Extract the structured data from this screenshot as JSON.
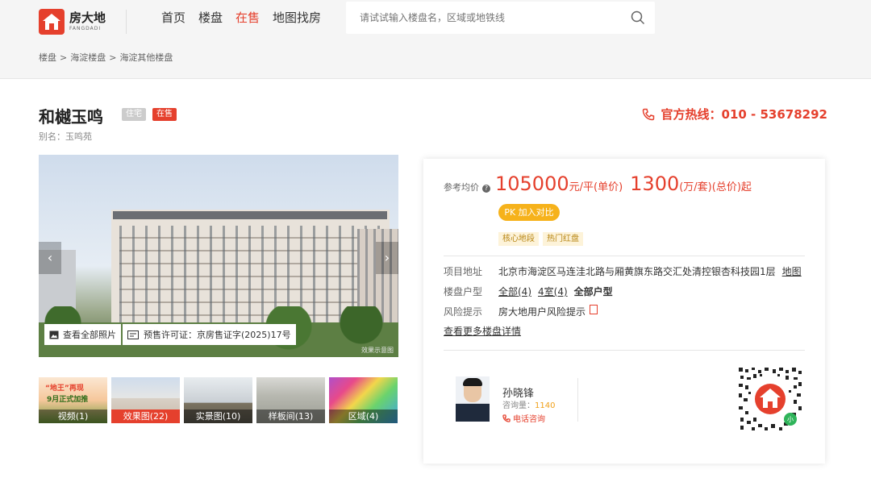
{
  "header": {
    "logo_cn": "房大地",
    "logo_en": "FANGDADI",
    "nav": [
      "首页",
      "楼盘",
      "在售",
      "地图找房"
    ],
    "nav_active_index": 2,
    "search_placeholder": "请试试输入楼盘名，区域或地铁线"
  },
  "breadcrumb": [
    "楼盘",
    "海淀楼盘",
    "海淀其他楼盘"
  ],
  "breadcrumb_sep": ">",
  "project": {
    "name": "和樾玉鸣",
    "type_tag": "住宅",
    "status_tag": "在售",
    "alias": "别名：玉鸣苑",
    "hotline": "官方热线：010 - 53678292"
  },
  "gallery": {
    "view_all": "查看全部照片",
    "permit": "预售许可证：京房售证字(2025)17号",
    "watermark": "效果示意图",
    "prev": "‹",
    "next": "›",
    "thumb_overlay": [
      "“地王”再现",
      "9月正式加推"
    ],
    "thumbs": [
      "视频(1)",
      "效果图(22)",
      "实景图(10)",
      "样板间(13)",
      "区域(4)"
    ],
    "selected_thumb": 1
  },
  "summary": {
    "price_label": "参考均价",
    "unit_price": "105000",
    "unit_price_suffix": "元/平(单价)",
    "total_price": "1300",
    "total_price_suffix": "(万/套)(总价)起",
    "pk_button": "PK 加入对比",
    "features": [
      "核心地段",
      "热门红盘"
    ],
    "address_label": "项目地址",
    "address": "北京市海淀区马连洼北路与厢黄旗东路交汇处清控银杏科技园1层",
    "map_link": "地图",
    "layout_label": "楼盘户型",
    "layouts": [
      "全部(4)",
      "4室(4)"
    ],
    "all_layouts": "全部户型",
    "risk_label": "风险提示",
    "risk_text": "房大地用户风险提示",
    "more_details": "查看更多楼盘详情"
  },
  "agent": {
    "name": "孙晓锋",
    "consult_label": "咨询量：",
    "consult_count": "1140",
    "call": "电话咨询"
  },
  "colors": {
    "accent": "#e5402d",
    "pk": "#f6b21b",
    "feature_bg": "#fdf3d9"
  }
}
